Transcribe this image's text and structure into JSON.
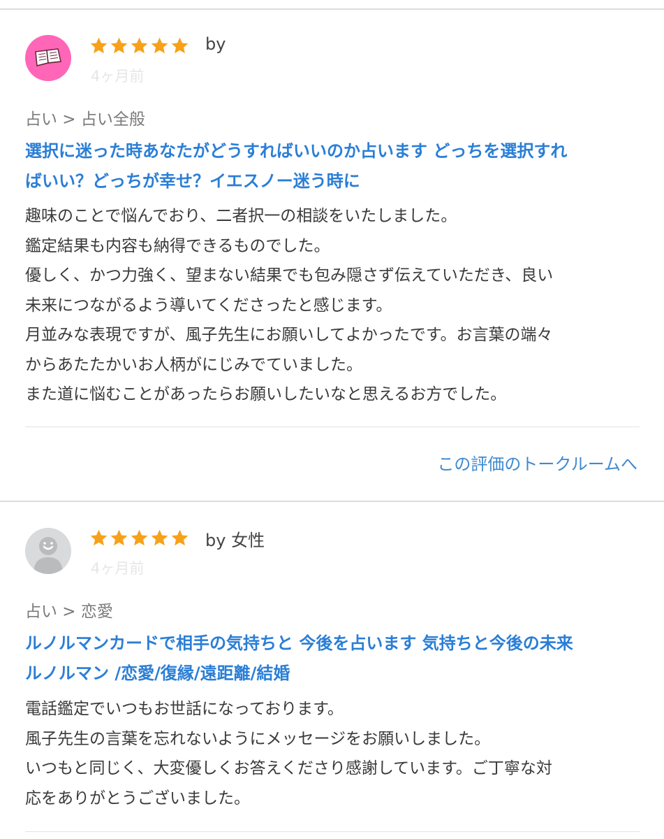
{
  "colors": {
    "accent": "#2a7ed6",
    "star": "#f7a11a",
    "avatar_pink": "#ff66b8",
    "avatar_gray": "#d9dadb"
  },
  "reviews": [
    {
      "avatar_icon": "book-icon",
      "rating": 5,
      "by": "by",
      "ago": "4ヶ月前",
      "category": "占い > 占い全般",
      "title_lines": [
        "選択に迷った時あなたがどうすればいいのか占います どっちを選択すれ",
        "ばいい？どっちが幸せ？イエスノー迷う時に"
      ],
      "body_lines": [
        "趣味のことで悩んでおり、二者択一の相談をいたしました。",
        "鑑定結果も内容も納得できるものでした。",
        "優しく、かつ力強く、望まない結果でも包み隠さず伝えていただき、良い",
        "未来につながるよう導いてくださったと感じます。",
        "月並みな表現ですが、風子先生にお願いしてよかったです。お言葉の端々",
        "からあたたかいお人柄がにじみでていました。",
        "また道に悩むことがあったらお願いしたいなと思えるお方でした。"
      ],
      "talkroom_link": "この評価のトークルームへ"
    },
    {
      "avatar_icon": "default-user-icon",
      "rating": 5,
      "by": "by 女性",
      "ago": "4ヶ月前",
      "category": "占い > 恋愛",
      "title_lines": [
        "ルノルマンカードで相手の気持ちと 今後を占います 気持ちと今後の未来",
        "ルノルマン /恋愛/復縁/遠距離/結婚"
      ],
      "body_lines": [
        "電話鑑定でいつもお世話になっております。",
        "風子先生の言葉を忘れないようにメッセージをお願いしました。",
        "いつもと同じく、大変優しくお答えくださり感謝しています。ご丁寧な対",
        "応をありがとうございました。"
      ]
    }
  ]
}
